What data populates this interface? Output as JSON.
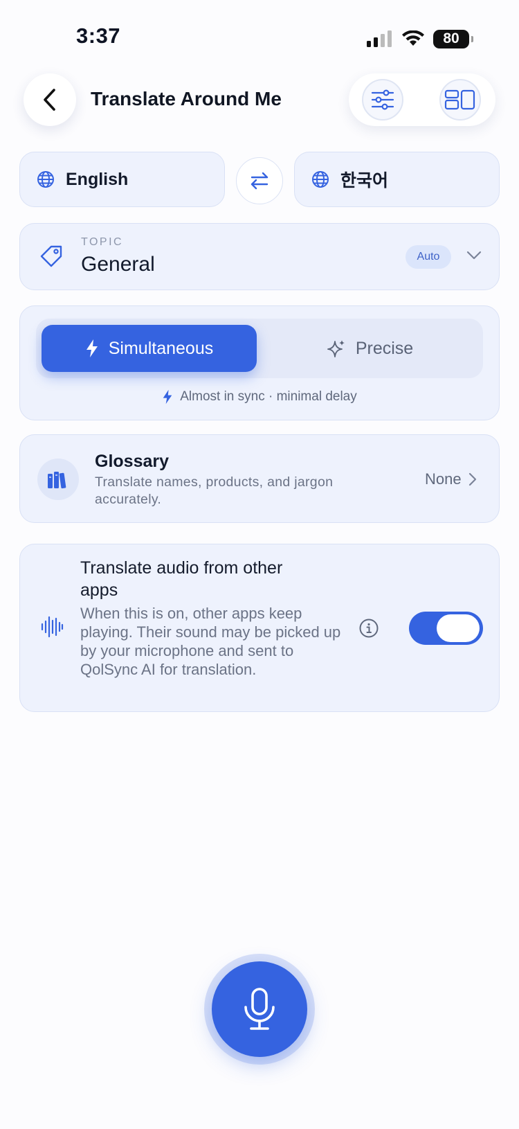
{
  "status_bar": {
    "time": "3:37",
    "battery": "80"
  },
  "header": {
    "title": "Translate Around Me",
    "icons": [
      "chevron-left-icon",
      "sliders-icon",
      "layout-panels-icon"
    ]
  },
  "languages": {
    "source": "English",
    "target": "한국어"
  },
  "topic": {
    "caption": "TOPIC",
    "value": "General",
    "badge": "Auto"
  },
  "mode": {
    "options": [
      "Simultaneous",
      "Precise"
    ],
    "selected": "Simultaneous",
    "hint": "Almost in sync · minimal delay"
  },
  "glossary": {
    "title": "Glossary",
    "description": "Translate names, products, and jargon accurately.",
    "value": "None"
  },
  "audio": {
    "title": "Translate audio from other apps",
    "description": "When this is on, other apps keep playing. Their sound may be picked up by your microphone and sent to QolSync AI for translation.",
    "enabled": true
  },
  "colors": {
    "accent": "#3563e0",
    "card_bg": "#eef2fd",
    "page_bg": "#fcfcfe"
  }
}
